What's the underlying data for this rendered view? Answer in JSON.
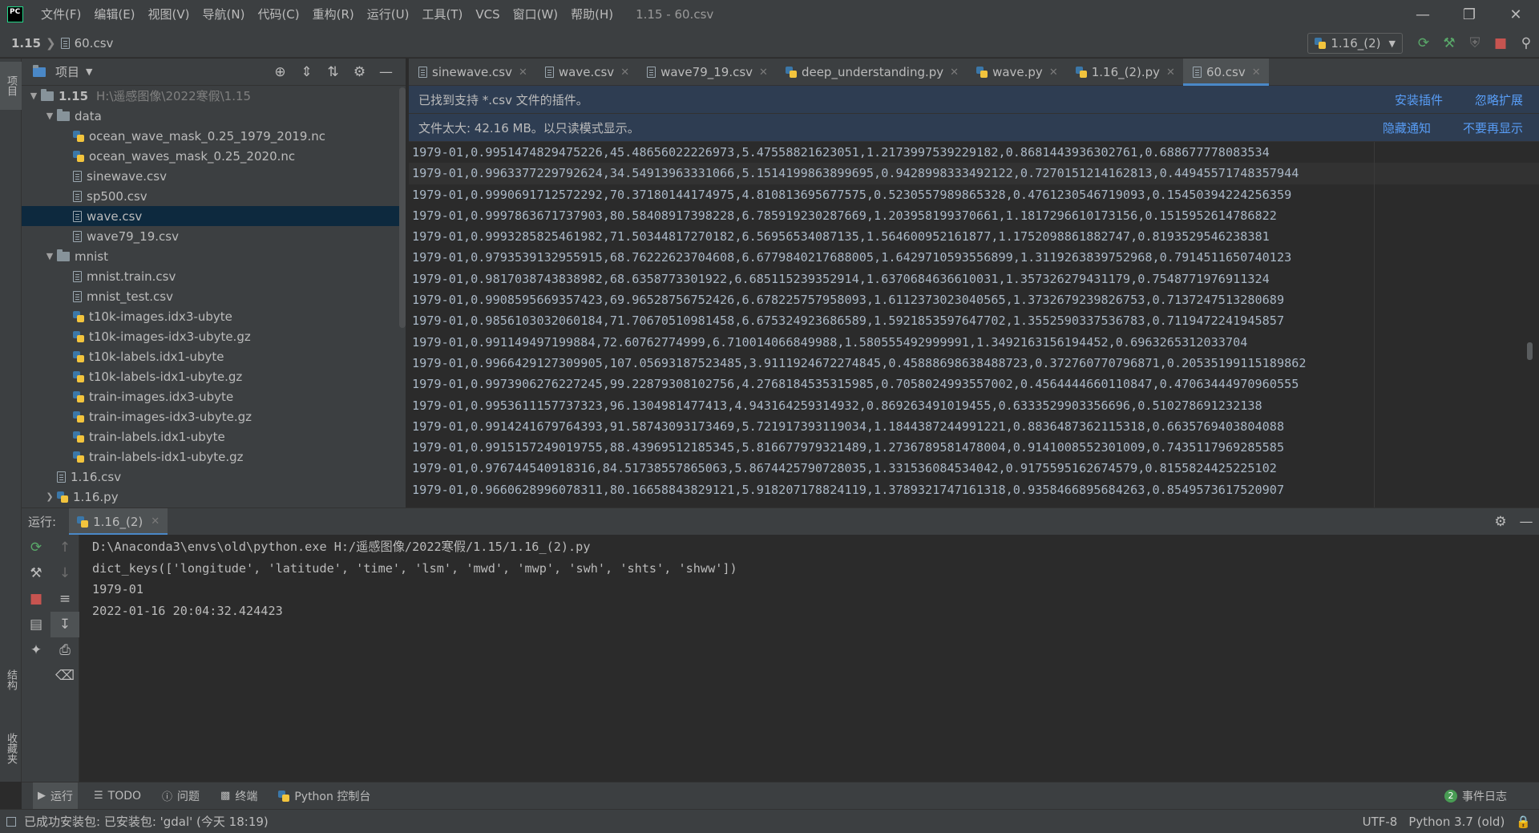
{
  "titlebar": {
    "menus": [
      "文件(F)",
      "编辑(E)",
      "视图(V)",
      "导航(N)",
      "代码(C)",
      "重构(R)",
      "运行(U)",
      "工具(T)",
      "VCS",
      "窗口(W)",
      "帮助(H)"
    ],
    "window_title": "1.15 - 60.csv"
  },
  "navbar": {
    "project": "1.15",
    "file": "60.csv",
    "run_config": "1.16_(2)"
  },
  "left_strip": {
    "project": "项目",
    "structure": "结构",
    "favorites": "收藏夹"
  },
  "project_panel": {
    "title": "项目",
    "root_name": "1.15",
    "root_path": "H:\\遥感图像\\2022寒假\\1.15",
    "tree": [
      {
        "label": "data",
        "type": "folder",
        "level": 1,
        "expanded": true
      },
      {
        "label": "ocean_wave_mask_0.25_1979_2019.nc",
        "type": "py",
        "level": 2
      },
      {
        "label": "ocean_waves_mask_0.25_2020.nc",
        "type": "py",
        "level": 2
      },
      {
        "label": "sinewave.csv",
        "type": "file",
        "level": 2
      },
      {
        "label": "sp500.csv",
        "type": "file",
        "level": 2
      },
      {
        "label": "wave.csv",
        "type": "file",
        "level": 2,
        "selected": true
      },
      {
        "label": "wave79_19.csv",
        "type": "file",
        "level": 2
      },
      {
        "label": "mnist",
        "type": "folder",
        "level": 1,
        "expanded": true
      },
      {
        "label": "mnist.train.csv",
        "type": "file",
        "level": 2
      },
      {
        "label": "mnist_test.csv",
        "type": "file",
        "level": 2
      },
      {
        "label": "t10k-images.idx3-ubyte",
        "type": "py",
        "level": 2
      },
      {
        "label": "t10k-images-idx3-ubyte.gz",
        "type": "py",
        "level": 2
      },
      {
        "label": "t10k-labels.idx1-ubyte",
        "type": "py",
        "level": 2
      },
      {
        "label": "t10k-labels-idx1-ubyte.gz",
        "type": "py",
        "level": 2
      },
      {
        "label": "train-images.idx3-ubyte",
        "type": "py",
        "level": 2
      },
      {
        "label": "train-images-idx3-ubyte.gz",
        "type": "py",
        "level": 2
      },
      {
        "label": "train-labels.idx1-ubyte",
        "type": "py",
        "level": 2
      },
      {
        "label": "train-labels-idx1-ubyte.gz",
        "type": "py",
        "level": 2
      },
      {
        "label": "1.16.csv",
        "type": "file",
        "level": 1
      },
      {
        "label": "1.16.py",
        "type": "py",
        "level": 1,
        "collapsed": true
      }
    ]
  },
  "editor": {
    "tabs": [
      {
        "label": "sinewave.csv",
        "type": "file",
        "active": false
      },
      {
        "label": "wave.csv",
        "type": "file",
        "active": false
      },
      {
        "label": "wave79_19.csv",
        "type": "file",
        "active": false
      },
      {
        "label": "deep_understanding.py",
        "type": "py",
        "active": false
      },
      {
        "label": "wave.py",
        "type": "py",
        "active": false
      },
      {
        "label": "1.16_(2).py",
        "type": "py",
        "active": false
      },
      {
        "label": "60.csv",
        "type": "file",
        "active": true
      }
    ],
    "plugin_notice": {
      "text": "已找到支持 *.csv 文件的插件。",
      "action1": "安装插件",
      "action2": "忽略扩展"
    },
    "size_notice": {
      "text": "文件太大: 42.16 MB。以只读模式显示。",
      "action1": "隐藏通知",
      "action2": "不要再显示"
    },
    "lines": [
      "1979-01,0.9951474829475226,45.48656022226973,5.47558821623051,1.2173997539229182,0.8681443936302761,0.688677778083534",
      "1979-01,0.9963377229792624,34.54913963331066,5.1514199863899695,0.9428998333492122,0.7270151214162813,0.44945571748357944",
      "1979-01,0.9990691712572292,70.37180144174975,4.810813695677575,0.5230557989865328,0.4761230546719093,0.15450394224256359",
      "1979-01,0.9997863671737903,80.58408917398228,6.785919230287669,1.203958199370661,1.1817296610173156,0.1515952614786822",
      "1979-01,0.9993285825461982,71.50344817270182,6.56956534087135,1.564600952161877,1.1752098861882747,0.8193529546238381",
      "1979-01,0.9793539132955915,68.76222623704608,6.6779840217688005,1.6429710593556899,1.3119263839752968,0.7914511650740123",
      "1979-01,0.9817038743838982,68.6358773301922,6.685115239352914,1.6370684636610031,1.357326279431179,0.7548771976911324",
      "1979-01,0.9908595669357423,69.96528756752426,6.678225757958093,1.6112373023040565,1.3732679239826753,0.7137247513280689",
      "1979-01,0.9856103032060184,71.70670510981458,6.675324923686589,1.5921853597647702,1.3552590337536783,0.7119472241945857",
      "1979-01,0.991149497199884,72.60762774999,6.710014066849988,1.580555492999991,1.3492163156194452,0.6963265312033704",
      "1979-01,0.9966429127309905,107.05693187523485,3.9111924672274845,0.45888698638488723,0.372760770796871,0.20535199115189862",
      "1979-01,0.9973906276227245,99.22879308102756,4.2768184535315985,0.7058024993557002,0.4564444660110847,0.47063444970960555",
      "1979-01,0.9953611157737323,96.1304981477413,4.943164259314932,0.869263491019455,0.6333529903356696,0.510278691232138",
      "1979-01,0.9914241679764393,91.58743093173469,5.721917393119034,1.1844387244991221,0.8836487362115318,0.6635769403804088",
      "1979-01,0.9915157249019755,88.43969512185345,5.816677979321489,1.2736789581478004,0.9141008552301009,0.7435117969285585",
      "1979-01,0.976744540918316,84.51738557865063,5.8674425790728035,1.331536084534042,0.9175595162674579,0.8155824425225102",
      "1979-01,0.9660628996078311,80.16658843829121,5.918207178824119,1.3789321747161318,0.9358466895684263,0.8549573617520907"
    ]
  },
  "run_panel": {
    "label": "运行:",
    "tab": "1.16_(2)",
    "console": [
      "D:\\Anaconda3\\envs\\old\\python.exe H:/遥感图像/2022寒假/1.15/1.16_(2).py",
      "dict_keys(['longitude', 'latitude', 'time', 'lsm', 'mwd', 'mwp', 'swh', 'shts', 'shww'])",
      "1979-01",
      "2022-01-16 20:04:32.424423"
    ]
  },
  "tool_tabs": {
    "run": "运行",
    "todo": "TODO",
    "problems": "问题",
    "terminal": "终端",
    "python_console": "Python 控制台",
    "event_log": "事件日志",
    "event_count": "2"
  },
  "statusbar": {
    "message": "已成功安装包: 已安装包: 'gdal' (今天 18:19)",
    "encoding": "UTF-8",
    "interpreter": "Python 3.7 (old)"
  }
}
